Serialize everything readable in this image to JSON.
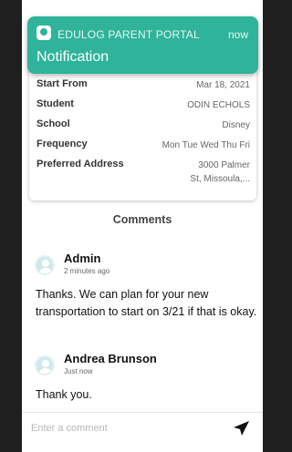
{
  "notification": {
    "app_name": "EDULOG PARENT PORTAL",
    "time": "now",
    "title": "Notification"
  },
  "details": [
    {
      "label": "Start From",
      "value": "Mar 18, 2021"
    },
    {
      "label": "Student",
      "value": "ODIN ECHOLS"
    },
    {
      "label": "School",
      "value": "Disney"
    },
    {
      "label": "Frequency",
      "value": "Mon Tue Wed Thu Fri"
    },
    {
      "label": "Preferred Address",
      "value_line1": "3000 Palmer",
      "value_line2": "St, Missoula,..."
    }
  ],
  "comments_heading": "Comments",
  "comments": [
    {
      "author": "Admin",
      "time": "2 minutes ago",
      "text": "Thanks. We can plan for your new transportation to start on 3/21 if that is okay."
    },
    {
      "author": "Andrea Brunson",
      "time": "Just now",
      "text": "Thank you."
    }
  ],
  "comment_input": {
    "placeholder": "Enter a comment",
    "value": ""
  },
  "icons": {
    "app": "edulog-app-icon",
    "avatar": "user-avatar-icon",
    "send": "send-icon"
  },
  "colors": {
    "accent": "#2fb39a"
  }
}
